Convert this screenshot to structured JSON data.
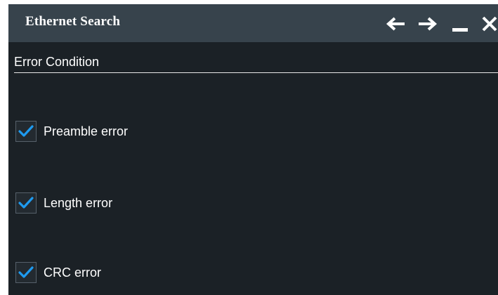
{
  "dialog": {
    "title": "Ethernet Search",
    "controls": [
      {
        "name": "back",
        "icon": "arrow-left-icon"
      },
      {
        "name": "forward",
        "icon": "arrow-right-icon"
      },
      {
        "name": "minimize",
        "icon": "minimize-icon"
      },
      {
        "name": "close",
        "icon": "close-icon"
      }
    ]
  },
  "error_condition": {
    "section_label": "Error Condition",
    "options": [
      {
        "label": "Preamble error",
        "checked": true
      },
      {
        "label": "Length error",
        "checked": true
      },
      {
        "label": "CRC error",
        "checked": true
      }
    ]
  },
  "colors": {
    "titlebar": "#37434c",
    "background": "#1b2126",
    "check_accent": "#1e9bf0",
    "text": "#ffffff"
  }
}
